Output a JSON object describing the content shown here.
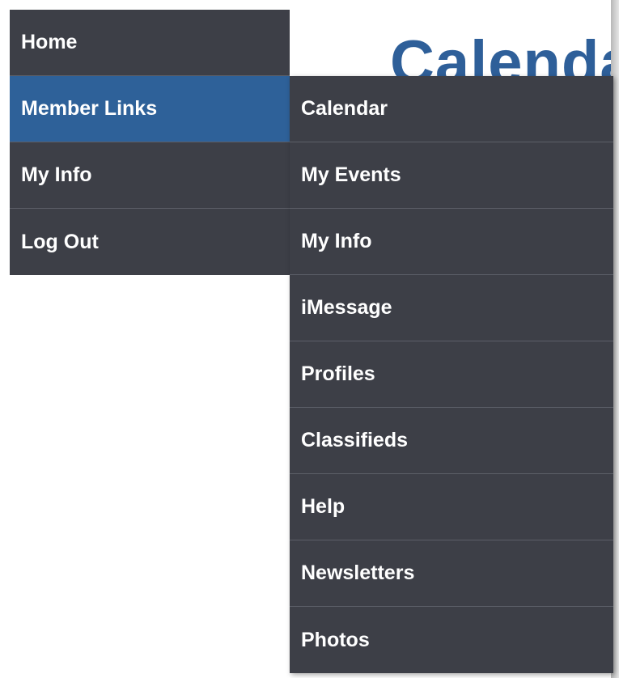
{
  "page": {
    "title": "Calendar"
  },
  "colors": {
    "menu_bg": "#3d3f47",
    "active_bg": "#2e6199",
    "divider": "#5c5f68",
    "title_color": "#2e5f99"
  },
  "primary_menu": {
    "items": [
      {
        "label": "Home"
      },
      {
        "label": "Member Links",
        "active": true
      },
      {
        "label": "My Info"
      },
      {
        "label": "Log Out"
      }
    ]
  },
  "submenu": {
    "items": [
      {
        "label": "Calendar"
      },
      {
        "label": "My Events"
      },
      {
        "label": "My Info"
      },
      {
        "label": "iMessage"
      },
      {
        "label": "Profiles"
      },
      {
        "label": "Classifieds"
      },
      {
        "label": "Help"
      },
      {
        "label": "Newsletters"
      },
      {
        "label": "Photos"
      }
    ]
  }
}
